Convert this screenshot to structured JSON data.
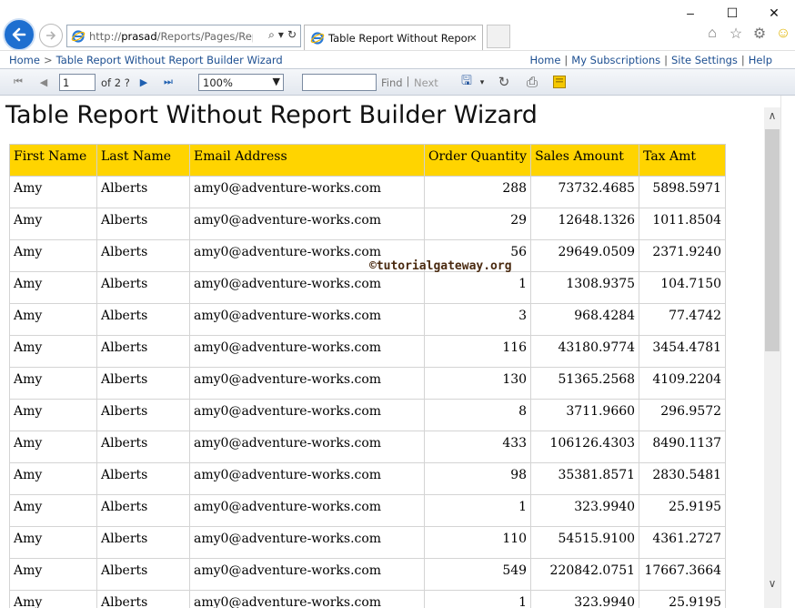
{
  "browser": {
    "url_prefix": "http://",
    "url_host": "prasad",
    "url_path": "/Reports/Pages/Repo",
    "tab_title": "Table Report Without Report Builder Wizard",
    "tab_title_visible": "Table Report Without Repor...",
    "tab_close": "×",
    "window_controls": [
      "–",
      "☐",
      "✕"
    ]
  },
  "navbar": {
    "home": "Home",
    "separator": ">",
    "current": "Table Report Without Report Builder Wizard",
    "links": [
      "Home",
      "My Subscriptions",
      "Site Settings",
      "Help"
    ],
    "link_separator": "|"
  },
  "toolbar": {
    "page_value": "1",
    "of_pages": "of 2 ?",
    "zoom_value": "100%",
    "find_value": "",
    "find_label": "Find",
    "find_sep": "|",
    "next_label": "Next"
  },
  "report": {
    "title": "Table Report Without Report Builder Wizard",
    "watermark": "©tutorialgateway.org",
    "columns": [
      "First Name",
      "Last Name",
      "Email Address",
      "Order Quantity",
      "Sales Amount",
      "Tax Amt"
    ],
    "rows": [
      [
        "Amy",
        "Alberts",
        "amy0@adventure-works.com",
        "288",
        "73732.4685",
        "5898.5971"
      ],
      [
        "Amy",
        "Alberts",
        "amy0@adventure-works.com",
        "29",
        "12648.1326",
        "1011.8504"
      ],
      [
        "Amy",
        "Alberts",
        "amy0@adventure-works.com",
        "56",
        "29649.0509",
        "2371.9240"
      ],
      [
        "Amy",
        "Alberts",
        "amy0@adventure-works.com",
        "1",
        "1308.9375",
        "104.7150"
      ],
      [
        "Amy",
        "Alberts",
        "amy0@adventure-works.com",
        "3",
        "968.4284",
        "77.4742"
      ],
      [
        "Amy",
        "Alberts",
        "amy0@adventure-works.com",
        "116",
        "43180.9774",
        "3454.4781"
      ],
      [
        "Amy",
        "Alberts",
        "amy0@adventure-works.com",
        "130",
        "51365.2568",
        "4109.2204"
      ],
      [
        "Amy",
        "Alberts",
        "amy0@adventure-works.com",
        "8",
        "3711.9660",
        "296.9572"
      ],
      [
        "Amy",
        "Alberts",
        "amy0@adventure-works.com",
        "433",
        "106126.4303",
        "8490.1137"
      ],
      [
        "Amy",
        "Alberts",
        "amy0@adventure-works.com",
        "98",
        "35381.8571",
        "2830.5481"
      ],
      [
        "Amy",
        "Alberts",
        "amy0@adventure-works.com",
        "1",
        "323.9940",
        "25.9195"
      ],
      [
        "Amy",
        "Alberts",
        "amy0@adventure-works.com",
        "110",
        "54515.9100",
        "4361.2727"
      ],
      [
        "Amy",
        "Alberts",
        "amy0@adventure-works.com",
        "549",
        "220842.0751",
        "17667.3664"
      ],
      [
        "Amy",
        "Alberts",
        "amy0@adventure-works.com",
        "1",
        "323.9940",
        "25.9195"
      ]
    ]
  },
  "colors": {
    "header_fill": "#ffd400",
    "link": "#1d4f91",
    "back_button": "#1e6fd0"
  }
}
